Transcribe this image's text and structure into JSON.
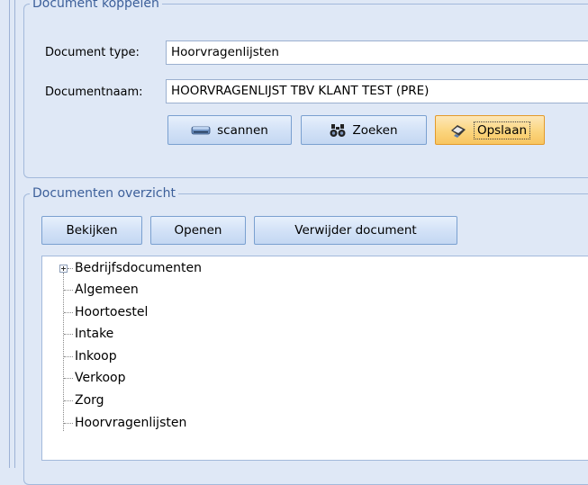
{
  "koppelen": {
    "legend": "Document koppelen",
    "doc_type_label": "Document type:",
    "doc_type_value": "Hoorvragenlijsten",
    "doc_name_label": "Documentnaam:",
    "doc_name_value": "HOORVRAGENLIJST TBV KLANT TEST (PRE)",
    "scan_label": "scannen",
    "zoeken_label": "Zoeken",
    "opslaan_label": "Opslaan"
  },
  "overzicht": {
    "legend": "Documenten overzicht",
    "bekijken_label": "Bekijken",
    "openen_label": "Openen",
    "verwijder_label": "Verwijder document",
    "tree": [
      "Bedrijfsdocumenten",
      "Algemeen",
      "Hoortoestel",
      "Intake",
      "Inkoop",
      "Verkoop",
      "Zorg",
      "Hoorvragenlijsten"
    ]
  },
  "colors": {
    "background": "#dfe8f6",
    "legend_text": "#3c5f9a",
    "button_active": "#fbd57e"
  },
  "icons": {
    "scan": "scanner-icon",
    "zoeken": "binoculars-icon",
    "opslaan": "save-icon",
    "expand": "plus-expand-icon"
  }
}
